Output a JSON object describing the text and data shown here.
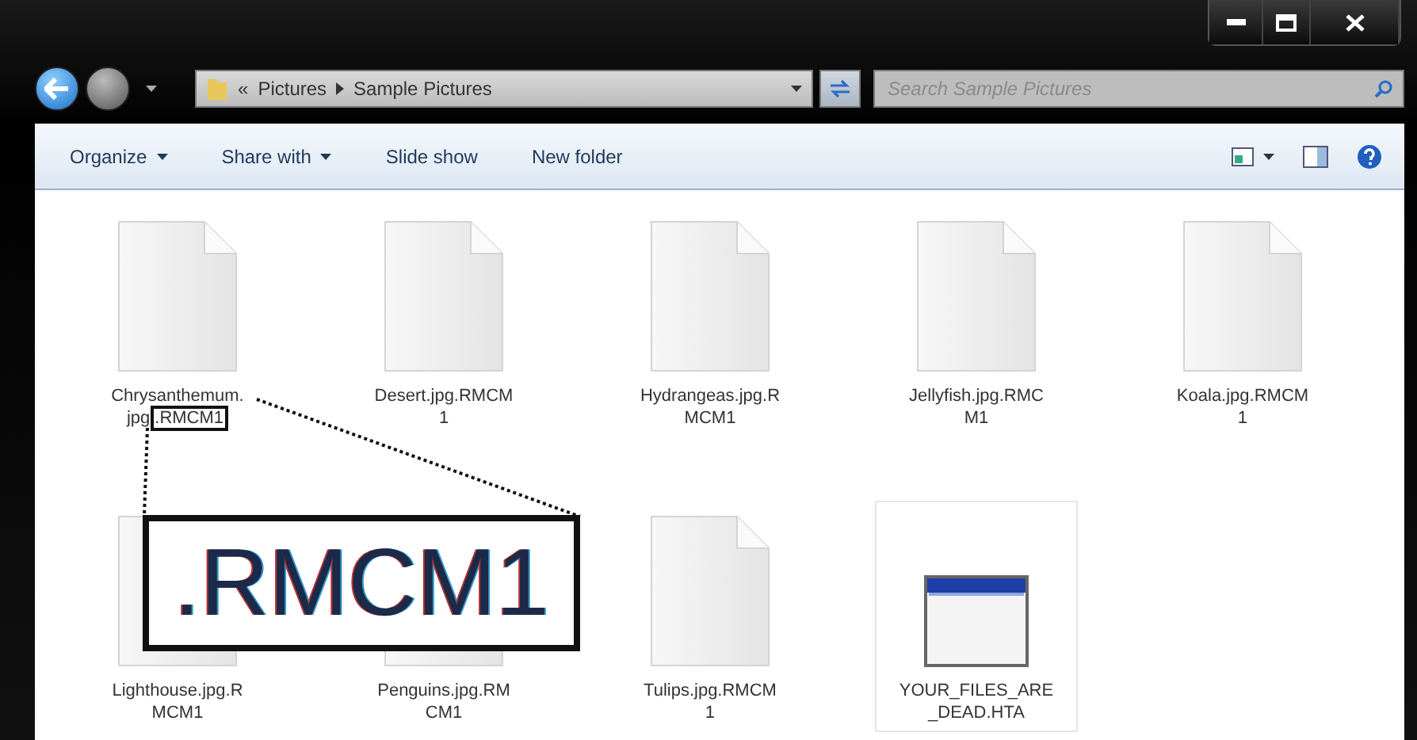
{
  "window": {
    "controls": [
      {
        "kind": "minimize"
      },
      {
        "kind": "maximize"
      },
      {
        "kind": "close"
      }
    ]
  },
  "address_bar": {
    "overflow": "«",
    "path": [
      "Pictures",
      "Sample Pictures"
    ]
  },
  "search": {
    "placeholder": "Search Sample Pictures"
  },
  "toolbar": {
    "commands": [
      {
        "label": "Organize",
        "dropdown": true
      },
      {
        "label": "Share with",
        "dropdown": true
      },
      {
        "label": "Slide show",
        "dropdown": false
      },
      {
        "label": "New folder",
        "dropdown": false
      }
    ]
  },
  "files": [
    {
      "kind": "document",
      "lines": [
        "Chrysanthemum.",
        "jpg"
      ],
      "marked_suffix": ".RMCM1",
      "selected": false
    },
    {
      "kind": "document",
      "lines": [
        "Desert.jpg.RMCM",
        "1"
      ],
      "selected": false
    },
    {
      "kind": "document",
      "lines": [
        "Hydrangeas.jpg.R",
        "MCM1"
      ],
      "selected": false
    },
    {
      "kind": "document",
      "lines": [
        "Jellyfish.jpg.RMC",
        "M1"
      ],
      "selected": false
    },
    {
      "kind": "document",
      "lines": [
        "Koala.jpg.RMCM",
        "1"
      ],
      "selected": false
    },
    {
      "kind": "document",
      "lines": [
        "Lighthouse.jpg.R",
        "MCM1"
      ],
      "selected": false
    },
    {
      "kind": "document",
      "lines": [
        "Penguins.jpg.RM",
        "CM1"
      ],
      "selected": false
    },
    {
      "kind": "document",
      "lines": [
        "Tulips.jpg.RMCM",
        "1"
      ],
      "selected": false
    },
    {
      "kind": "application",
      "lines": [
        "YOUR_FILES_ARE",
        "_DEAD.HTA"
      ],
      "selected": true
    }
  ],
  "callout": {
    "text": ".RMCM1"
  }
}
